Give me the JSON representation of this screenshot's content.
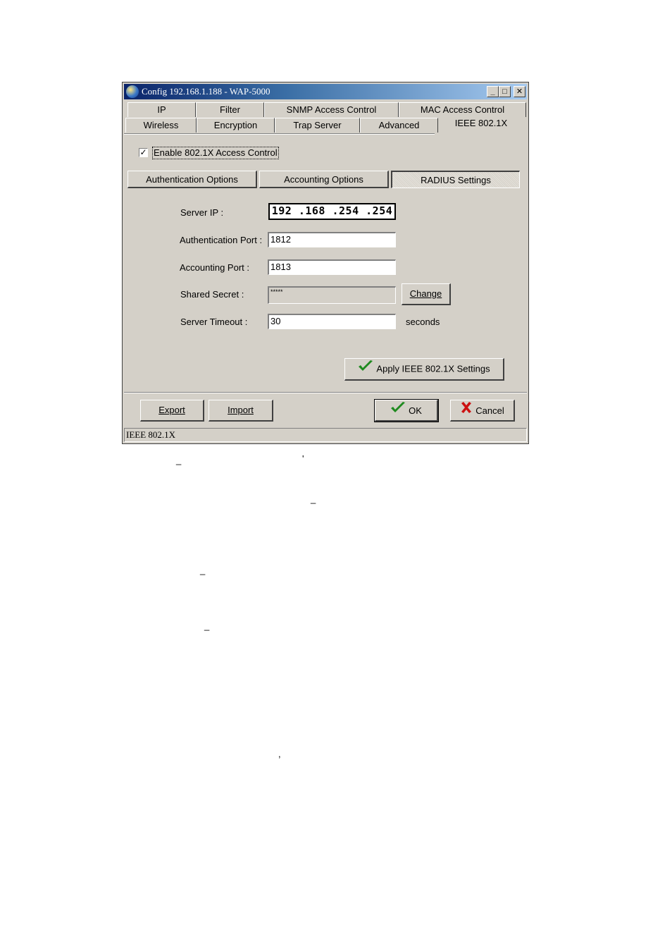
{
  "window": {
    "title": "Config 192.168.1.188 - WAP-5000",
    "caption_buttons": {
      "minimize": "_",
      "maximize": "□",
      "close": "✕"
    }
  },
  "tabs_row1": [
    "IP",
    "Filter",
    "SNMP Access Control",
    "MAC Access Control"
  ],
  "tabs_row2": [
    "Wireless",
    "Encryption",
    "Trap Server",
    "Advanced",
    "IEEE 802.1X"
  ],
  "active_tab": "IEEE 802.1X",
  "enable_8021x": {
    "label": "Enable 802.1X Access Control",
    "checked": true,
    "mark": "✓"
  },
  "subtabs": [
    "Authentication Options",
    "Accounting Options",
    "RADIUS Settings"
  ],
  "active_subtab": "RADIUS Settings",
  "radius": {
    "server_ip_label": "Server IP :",
    "server_ip": "192 .168 .254 .254",
    "auth_port_label": "Authentication Port :",
    "auth_port": "1812",
    "acct_port_label": "Accounting Port :",
    "acct_port": "1813",
    "secret_label": "Shared Secret :",
    "secret": "*****",
    "change_label": "Change",
    "timeout_label": "Server Timeout :",
    "timeout": "30",
    "timeout_unit": "seconds",
    "apply_label": "Apply IEEE 802.1X Settings"
  },
  "footer": {
    "export_label": "Export",
    "import_label": "Import",
    "ok_label": "OK",
    "cancel_label": "Cancel"
  },
  "status_text": "IEEE 802.1X",
  "page_marks": {
    "dash": "_",
    "tick": "'",
    "comma": ","
  },
  "colors": {
    "title_start": "#0a246a",
    "title_end": "#a6caf0",
    "face": "#d4d0c8",
    "ok_check": "#1f8a1f",
    "cancel_x": "#cc1111"
  }
}
